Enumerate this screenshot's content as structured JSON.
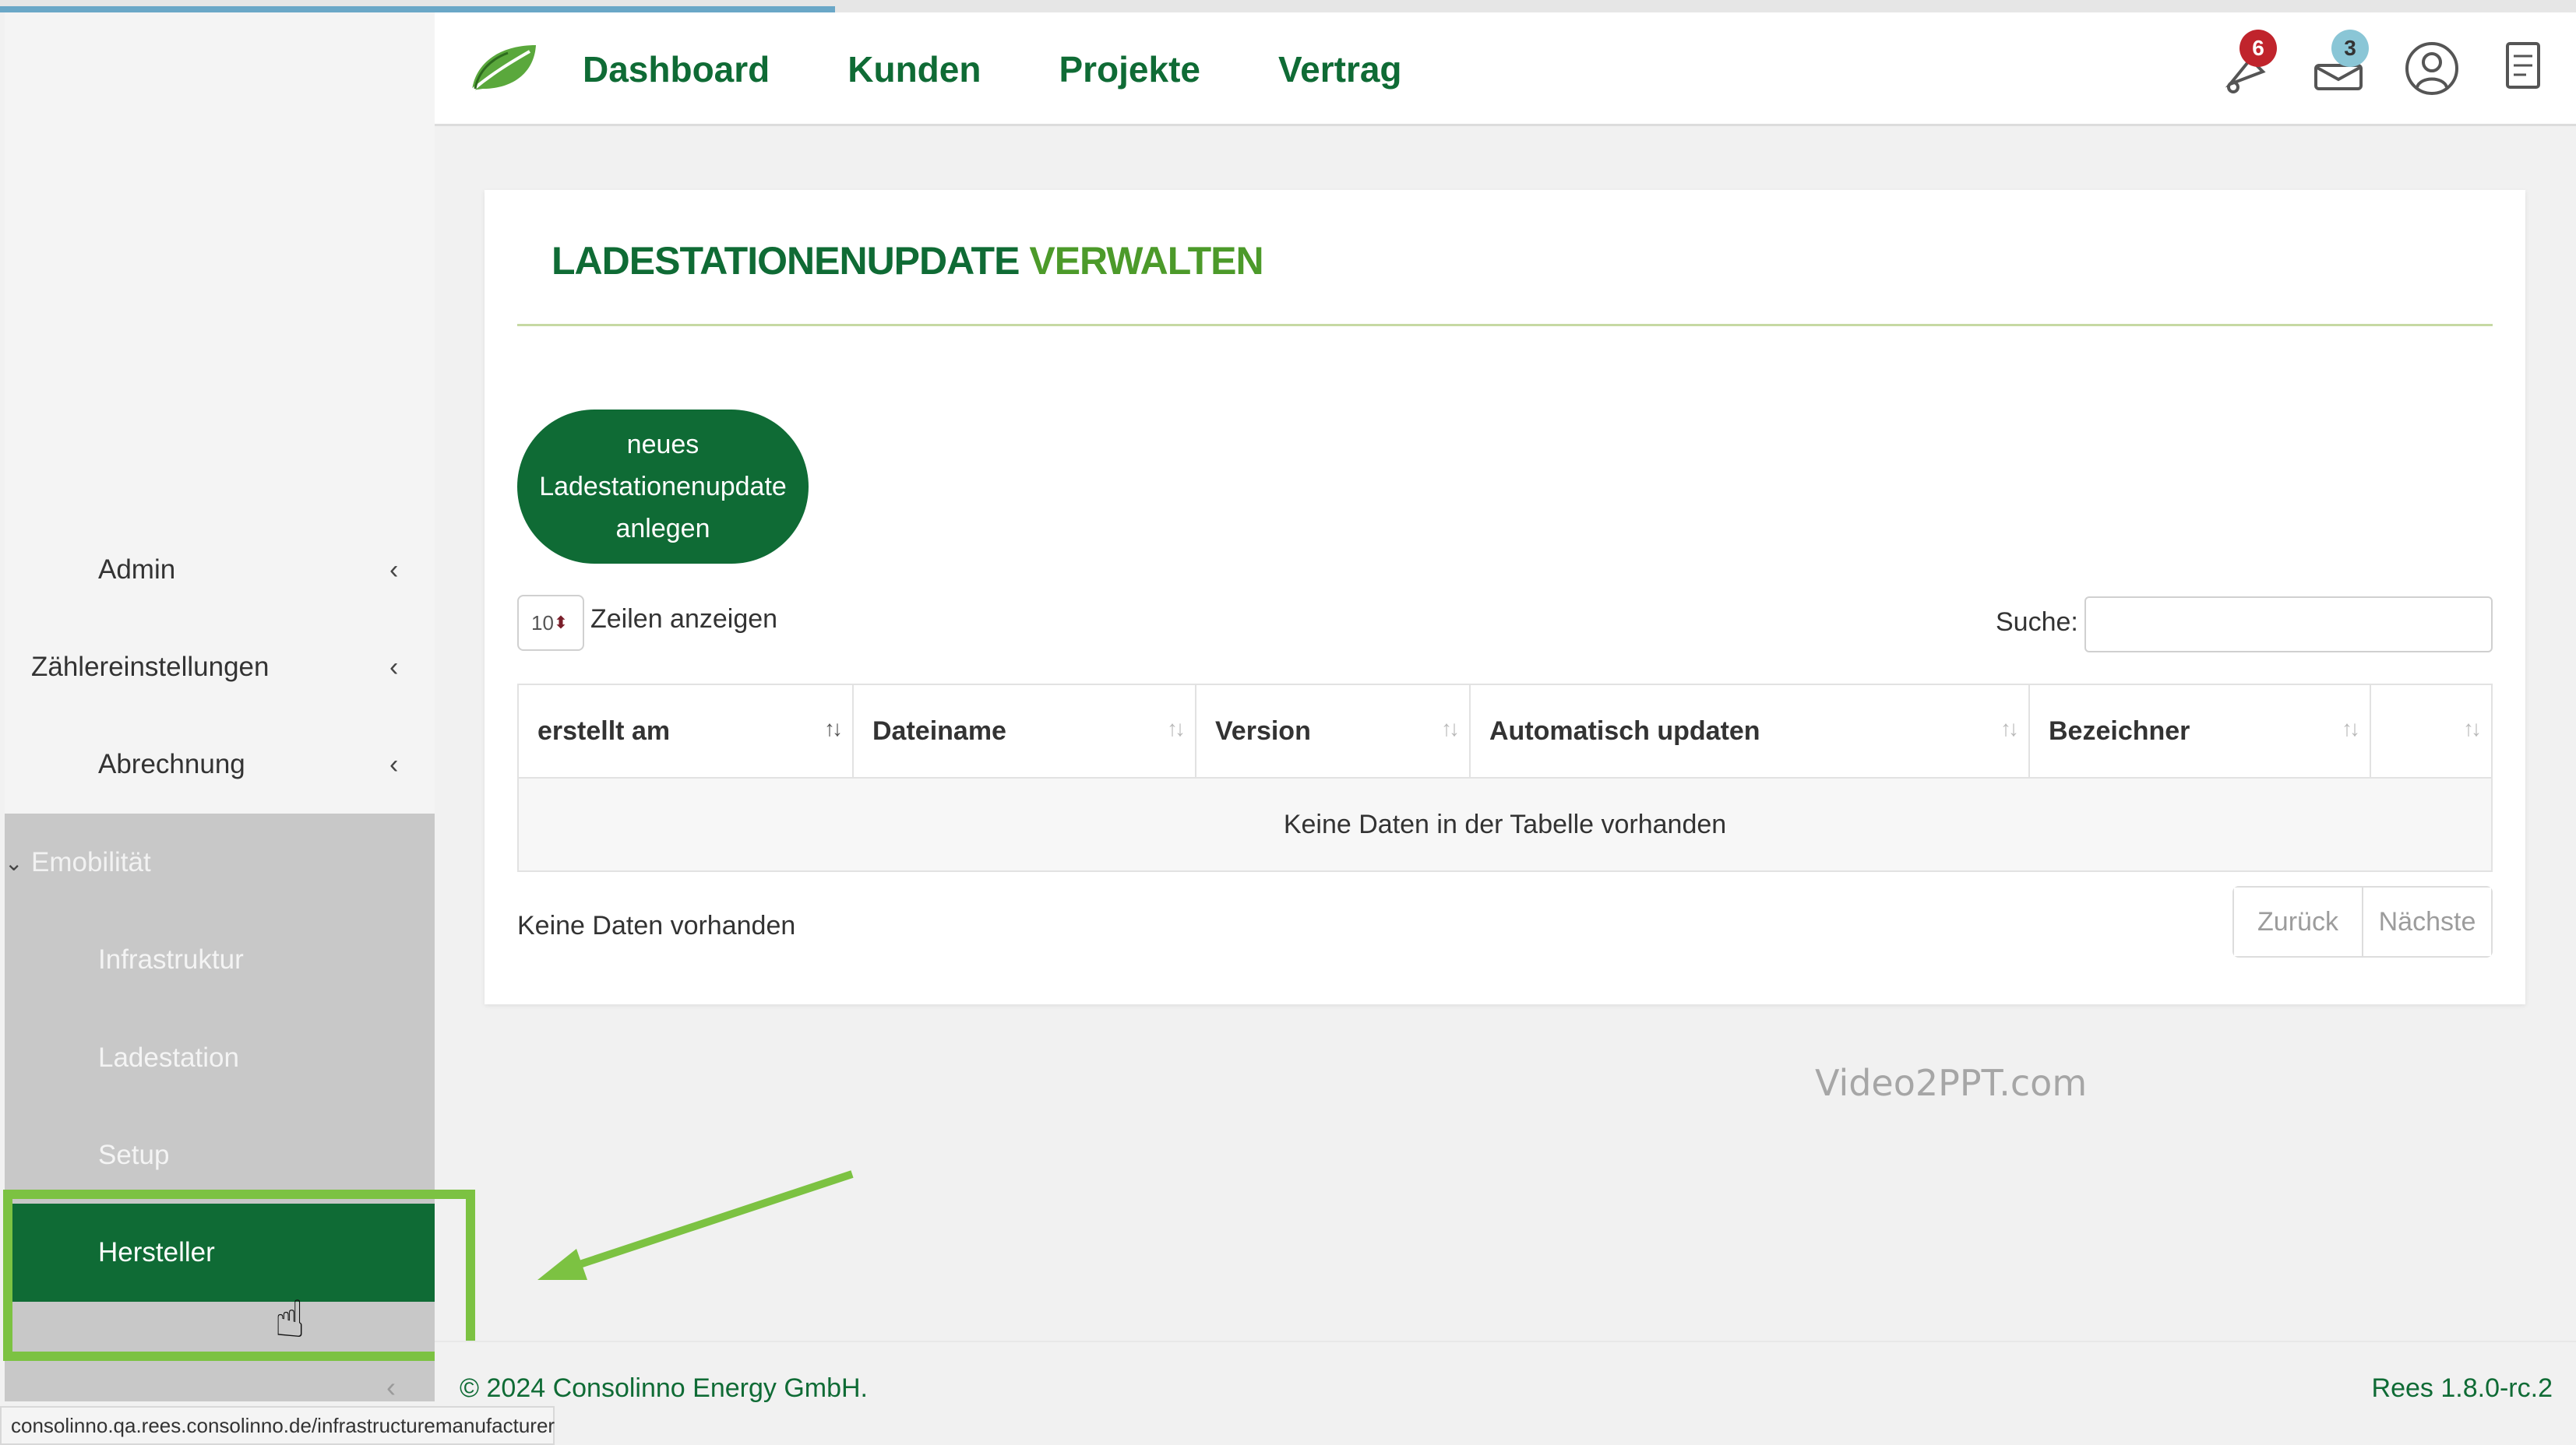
{
  "nav": {
    "dashboard": "Dashboard",
    "kunden": "Kunden",
    "projekte": "Projekte",
    "vertrag": "Vertrag"
  },
  "header_icons": {
    "notifications_badge": "6",
    "messages_badge": "3",
    "badge_colors": [
      "#c0242c",
      "#8ac6d6"
    ]
  },
  "sidebar": {
    "items": [
      {
        "label": "Admin"
      },
      {
        "label": "Zählereinstellungen"
      },
      {
        "label": "Abrechnung"
      }
    ],
    "group": {
      "label": "Emobilität",
      "children": [
        {
          "label": "Infrastruktur"
        },
        {
          "label": "Ladestation"
        },
        {
          "label": "Setup"
        },
        {
          "label": "Hersteller"
        }
      ]
    }
  },
  "card": {
    "title_part1": "LADESTATIONENUPDATE",
    "title_part2": "VERWALTEN",
    "new_button_line1": "neues",
    "new_button_line2": "Ladestationenupdate",
    "new_button_line3": "anlegen",
    "page_length_value": "10",
    "page_length_label": "Zeilen anzeigen",
    "search_label": "Suche:",
    "columns": [
      "erstellt am",
      "Dateiname",
      "Version",
      "Automatisch updaten",
      "Bezeichner",
      ""
    ],
    "empty_message": "Keine Daten in der Tabelle vorhanden",
    "info": "Keine Daten vorhanden",
    "prev": "Zurück",
    "next": "Nächste"
  },
  "watermark": "Video2PPT.com",
  "footer": {
    "copyright": "© 2024 Consolinno Energy GmbH.",
    "version": "Rees 1.8.0-rc.2"
  },
  "status_url": "consolinno.qa.rees.consolinno.de/infrastructuremanufacturer",
  "colors": {
    "brand_green": "#0f6b35",
    "accent_green": "#4c9a2a",
    "highlight": "#7cc242"
  }
}
